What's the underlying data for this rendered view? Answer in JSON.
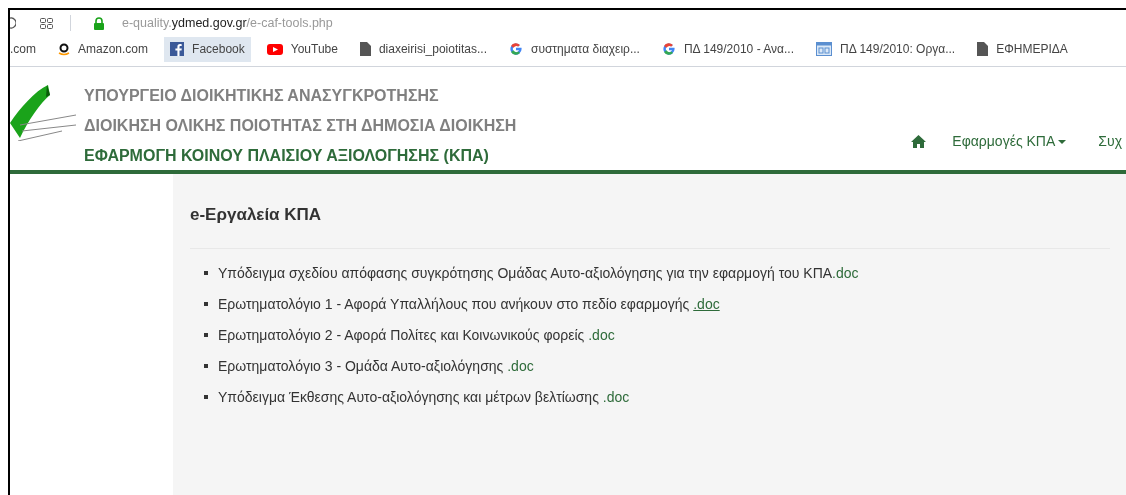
{
  "browser": {
    "url": {
      "subdomain": "e-quality.",
      "domain": "ydmed.gov.gr",
      "path": "/e-caf-tools.php"
    },
    "bookmarks": [
      {
        "kind": "none",
        "label": ".com",
        "selected": false
      },
      {
        "kind": "amazon",
        "label": "Amazon.com",
        "selected": false
      },
      {
        "kind": "facebook",
        "label": "Facebook",
        "selected": true
      },
      {
        "kind": "youtube",
        "label": "YouTube",
        "selected": false
      },
      {
        "kind": "file",
        "label": "diaxeirisi_poiotitas...",
        "selected": false
      },
      {
        "kind": "google",
        "label": "συστηματα διαχειρ...",
        "selected": false
      },
      {
        "kind": "google",
        "label": "ΠΔ 149/2010 - Ανα...",
        "selected": false
      },
      {
        "kind": "page",
        "label": "ΠΔ 149/2010: Οργα...",
        "selected": false
      },
      {
        "kind": "file",
        "label": "ΕΦΗΜΕΡΙΔΑ",
        "selected": false
      }
    ]
  },
  "header": {
    "lines": [
      "ΥΠΟΥΡΓΕΙΟ ΔΙΟΙΚΗΤΙΚΗΣ ΑΝΑΣΥΓΚΡΟΤΗΣΗΣ",
      "ΔΙΟΙΚΗΣΗ ΟΛΙΚΗΣ ΠΟΙΟΤΗΤΑΣ ΣΤΗ ΔΗΜΟΣΙΑ ΔΙΟΙΚΗΣΗ"
    ],
    "app_title": "ΕΦΑΡΜΟΓΗ ΚΟΙΝΟΥ ΠΛΑΙΣΙΟΥ ΑΞΙΟΛΟΓΗΣΗΣ (ΚΠΑ)",
    "nav": [
      {
        "kind": "home"
      },
      {
        "kind": "dropdown",
        "label": "Εφαρμογές ΚΠΑ"
      },
      {
        "kind": "link",
        "label": "Συχ"
      }
    ]
  },
  "content": {
    "title": "e-Εργαλεία ΚΠΑ",
    "items": [
      {
        "text": "Υπόδειγμα σχεδίου απόφασης συγκρότησης Ομάδας Αυτο-αξιολόγησης για την εφαρμογή του ΚΠΑ",
        "link": ".doc",
        "underlined": false
      },
      {
        "text": "Ερωτηματολόγιο 1 - Αφορά Υπαλλήλους που ανήκουν στο πεδίο εφαρμογής ",
        "link": ".doc",
        "underlined": true
      },
      {
        "text": "Ερωτηματολόγιο 2 - Αφορά Πολίτες και Κοινωνικούς φορείς ",
        "link": ".doc",
        "underlined": false
      },
      {
        "text": "Ερωτηματολόγιο 3 - Ομάδα Αυτο-αξιολόγησης ",
        "link": ".doc",
        "underlined": false
      },
      {
        "text": "Υπόδειγμα Έκθεσης Αυτο-αξιολόγησης και μέτρων βελτίωσης ",
        "link": ".doc",
        "underlined": false
      }
    ]
  }
}
